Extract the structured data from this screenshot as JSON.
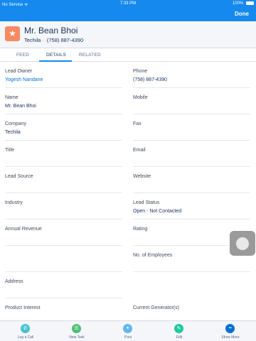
{
  "status_bar": {
    "carrier": "No Service ᯤ",
    "time": "7:33 PM",
    "battery": "100%"
  },
  "nav": {
    "done_label": "Done"
  },
  "record": {
    "icon_glyph": "★",
    "icon_color": "#f88962",
    "name": "Mr. Bean Bhoi",
    "company": "Techila",
    "phone": "(758) 887-4390"
  },
  "tabs": [
    {
      "label": "FEED",
      "active": false
    },
    {
      "label": "DETAILS",
      "active": true
    },
    {
      "label": "RELATED",
      "active": false
    }
  ],
  "fields": [
    {
      "label": "Lead Owner",
      "value": "Yogesh Nandane",
      "link": true
    },
    {
      "label": "Phone",
      "value": "(758) 887-4390"
    },
    {
      "label": "Name",
      "value": "Mr. Bean Bhoi"
    },
    {
      "label": "Mobile",
      "value": ""
    },
    {
      "label": "Company",
      "value": "Techila"
    },
    {
      "label": "Fax",
      "value": ""
    },
    {
      "label": "Title",
      "value": ""
    },
    {
      "label": "Email",
      "value": ""
    },
    {
      "label": "Lead Source",
      "value": ""
    },
    {
      "label": "Website",
      "value": ""
    },
    {
      "label": "Industry",
      "value": ""
    },
    {
      "label": "Lead Status",
      "value": "Open - Not Contacted"
    },
    {
      "label": "Annual Revenue",
      "value": ""
    },
    {
      "label": "Rating",
      "value": ""
    },
    {
      "label": "No. of Employees",
      "value": ""
    },
    {
      "label": "Address",
      "value": ""
    },
    {
      "label": "Product Interest",
      "value": ""
    },
    {
      "label": "Current Generator(s)",
      "value": ""
    }
  ],
  "actions": [
    {
      "label": "Log a Call",
      "icon": "phone-icon",
      "glyph": "✆",
      "color": "#48c3cc"
    },
    {
      "label": "New Task",
      "icon": "task-list-icon",
      "glyph": "☰",
      "color": "#4bc076"
    },
    {
      "label": "Post",
      "icon": "chat-bubble-icon",
      "glyph": "●",
      "color": "#62b7ed"
    },
    {
      "label": "Edit",
      "icon": "pencil-icon",
      "glyph": "✎",
      "color": "#1fcaa0"
    },
    {
      "label": "Show More",
      "icon": "more-icon",
      "glyph": "•••",
      "color": "#0070d2"
    }
  ],
  "colors": {
    "brand": "#1589ee",
    "link": "#0070d2",
    "header_bg": "#f4f6f9"
  }
}
